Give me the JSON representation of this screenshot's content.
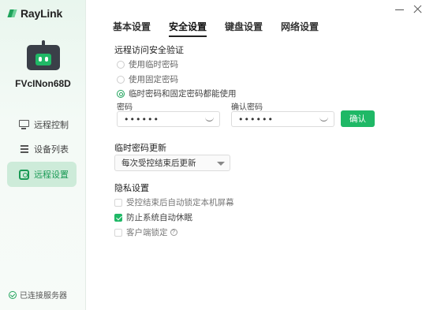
{
  "app": {
    "logo_text": "RayLink",
    "brand_color": "#1fb866"
  },
  "device": {
    "name": "FVcINon68D"
  },
  "sidebar": {
    "items": [
      {
        "label": "远程控制",
        "icon": "monitor-icon",
        "active": false
      },
      {
        "label": "设备列表",
        "icon": "list-icon",
        "active": false
      },
      {
        "label": "远程设置",
        "icon": "settings-icon",
        "active": true
      }
    ],
    "status": "已连接服务器"
  },
  "tabs": [
    {
      "label": "基本设置",
      "active": false
    },
    {
      "label": "安全设置",
      "active": true
    },
    {
      "label": "键盘设置",
      "active": false
    },
    {
      "label": "网络设置",
      "active": false
    }
  ],
  "security": {
    "title": "远程访问安全验证",
    "options": [
      {
        "label": "使用临时密码",
        "selected": false
      },
      {
        "label": "使用固定密码",
        "selected": false
      },
      {
        "label": "临时密码和固定密码都能使用",
        "selected": true
      }
    ],
    "password_label": "密码",
    "password_value": "••••••",
    "confirm_label": "确认密码",
    "confirm_value": "••••••",
    "confirm_button": "确认"
  },
  "temp_password": {
    "title": "临时密码更新",
    "selected": "每次受控结束后更新"
  },
  "privacy": {
    "title": "隐私设置",
    "options": [
      {
        "label": "受控结束后自动锁定本机屏幕",
        "checked": false
      },
      {
        "label": "防止系统自动休眠",
        "checked": true
      },
      {
        "label": "客户端锁定",
        "checked": false
      }
    ],
    "help_glyph": "?"
  }
}
